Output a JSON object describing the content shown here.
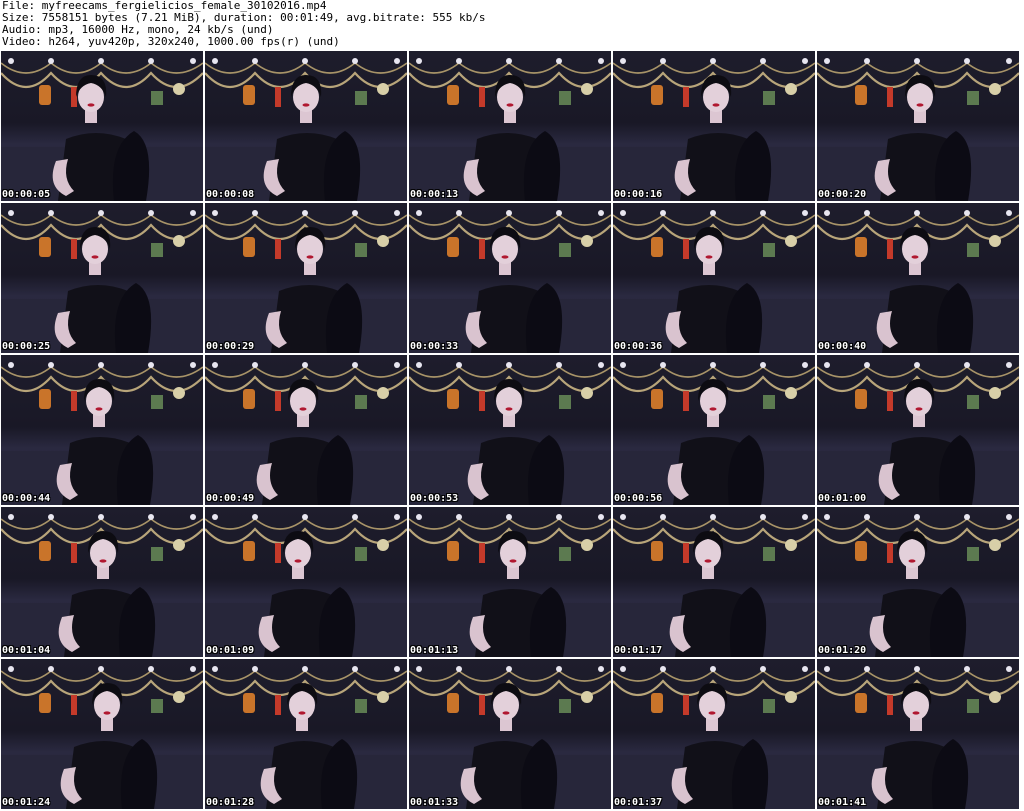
{
  "header": {
    "lines": [
      "File: myfreecams_fergielicios_female_30102016.mp4",
      "Size: 7558151 bytes (7.21 MiB), duration: 00:01:49, avg.bitrate: 555 kb/s",
      "Audio: mp3, 16000 Hz, mono, 24 kb/s (und)",
      "Video: h264, yuv420p, 320x240, 1000.00 fps(r) (und)"
    ]
  },
  "thumbnails": [
    {
      "timestamp": "00:00:05"
    },
    {
      "timestamp": "00:00:08"
    },
    {
      "timestamp": "00:00:13"
    },
    {
      "timestamp": "00:00:16"
    },
    {
      "timestamp": "00:00:20"
    },
    {
      "timestamp": "00:00:25"
    },
    {
      "timestamp": "00:00:29"
    },
    {
      "timestamp": "00:00:33"
    },
    {
      "timestamp": "00:00:36"
    },
    {
      "timestamp": "00:00:40"
    },
    {
      "timestamp": "00:00:44"
    },
    {
      "timestamp": "00:00:49"
    },
    {
      "timestamp": "00:00:53"
    },
    {
      "timestamp": "00:00:56"
    },
    {
      "timestamp": "00:01:00"
    },
    {
      "timestamp": "00:01:04"
    },
    {
      "timestamp": "00:01:09"
    },
    {
      "timestamp": "00:01:13"
    },
    {
      "timestamp": "00:01:17"
    },
    {
      "timestamp": "00:01:20"
    },
    {
      "timestamp": "00:01:24"
    },
    {
      "timestamp": "00:01:28"
    },
    {
      "timestamp": "00:01:33"
    },
    {
      "timestamp": "00:01:37"
    },
    {
      "timestamp": "00:01:41"
    }
  ],
  "colors": {
    "background": "#ffffff",
    "text": "#000000",
    "timestamp_text": "#ffffff"
  }
}
